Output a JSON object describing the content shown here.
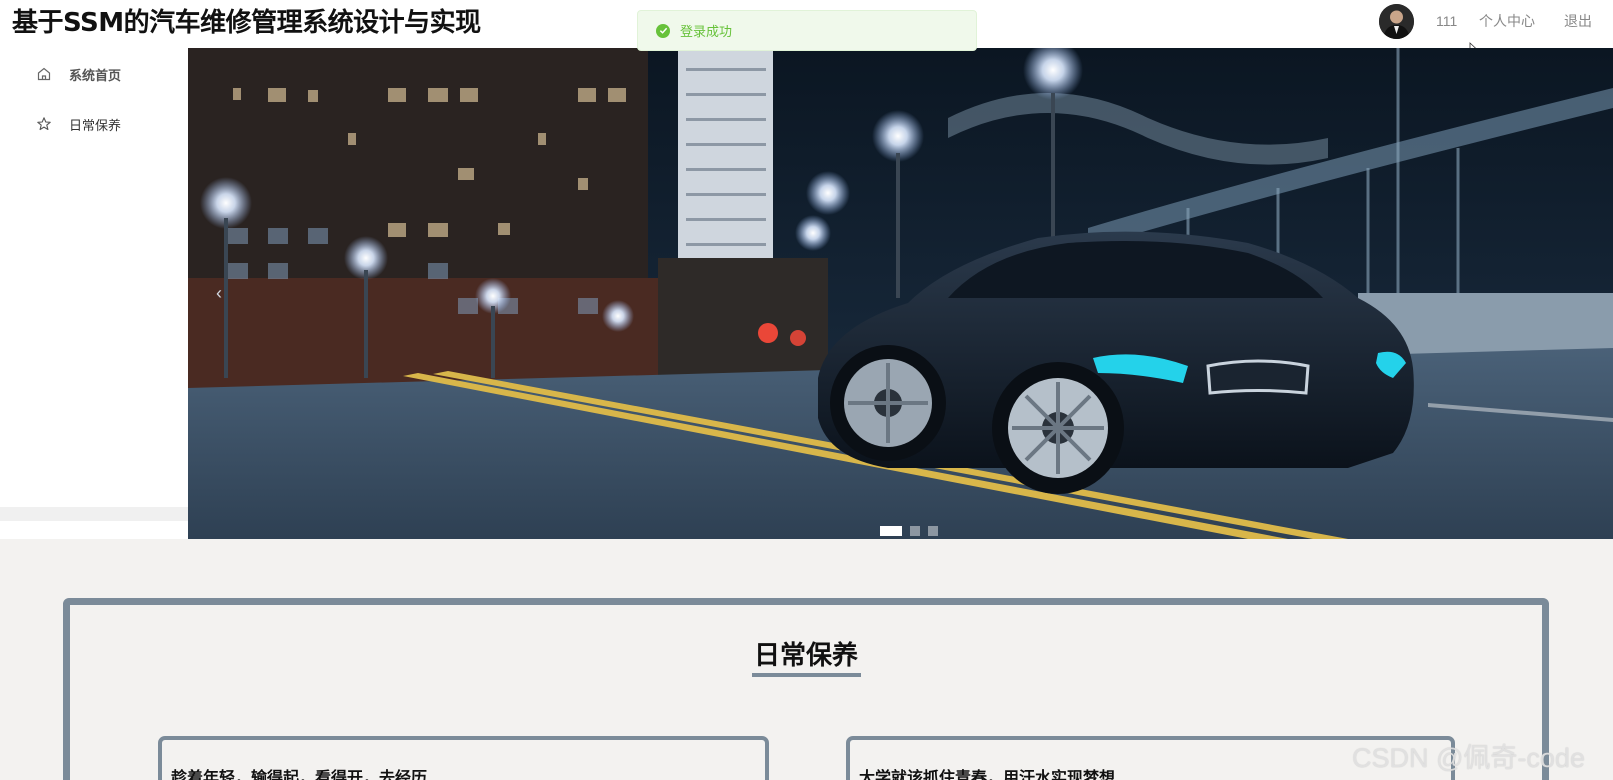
{
  "header": {
    "title": "基于SSM的汽车维修管理系统设计与实现",
    "user_name": "111",
    "personal_center": "个人中心",
    "logout": "退出"
  },
  "toast": {
    "message": "登录成功",
    "icon": "check-circle-icon",
    "color": "#67c23a"
  },
  "sidebar": {
    "items": [
      {
        "label": "系统首页",
        "icon": "home-icon"
      },
      {
        "label": "日常保养",
        "icon": "star-icon"
      }
    ]
  },
  "carousel": {
    "prev_glyph": "‹",
    "slide_count": 3,
    "active_index": 0
  },
  "section": {
    "title": "日常保养",
    "cards": [
      {
        "title": "趁着年轻，输得起，看得开，去经历"
      },
      {
        "title": "大学就该抓住青春，用汗水实现梦想"
      }
    ]
  },
  "watermark": "CSDN @佩奇-code",
  "colors": {
    "accent": "#7b8b99",
    "success": "#67c23a",
    "page_bg": "#f3f2f0"
  }
}
